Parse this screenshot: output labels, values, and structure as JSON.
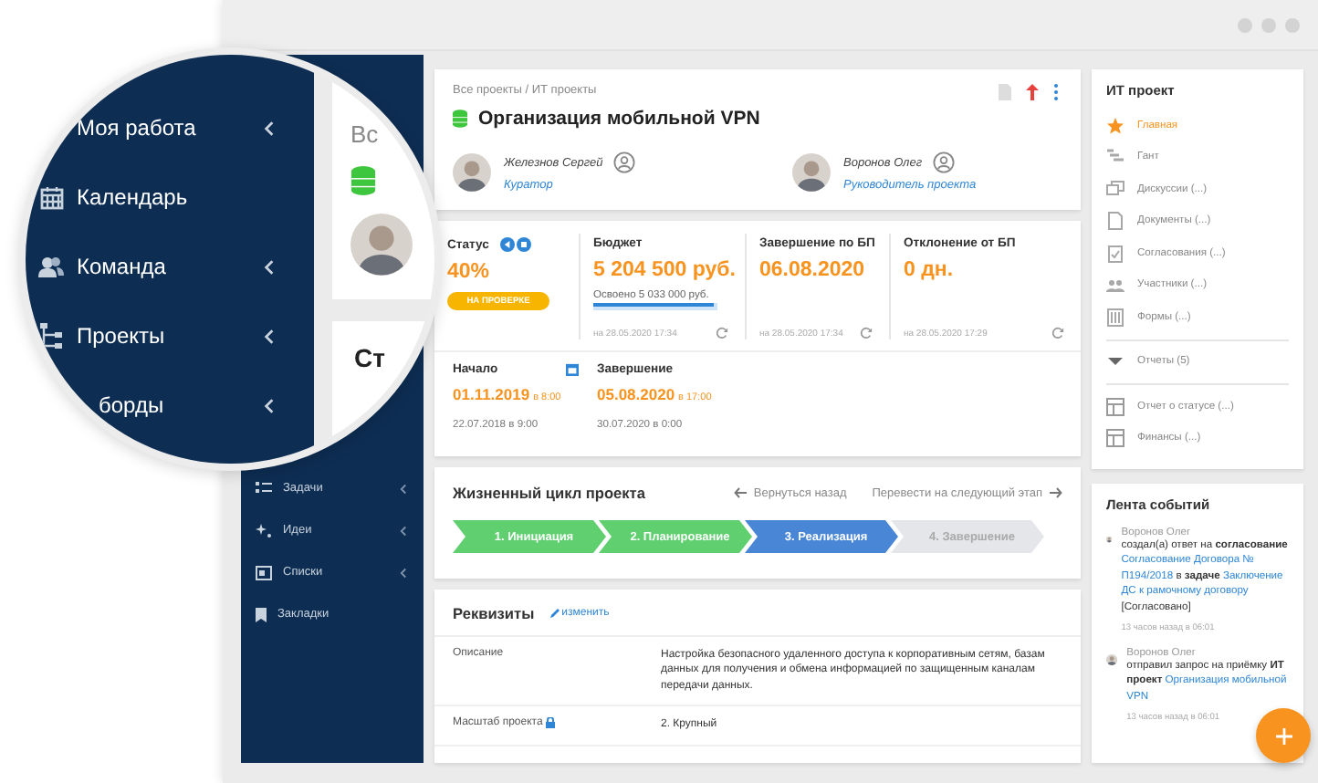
{
  "magnifier": {
    "menu": [
      {
        "label": "Моя работа",
        "expandable": true
      },
      {
        "label": "Календарь",
        "expandable": false
      },
      {
        "label": "Команда",
        "expandable": true
      },
      {
        "label": "Проекты",
        "expandable": true
      },
      {
        "label": "борды",
        "expandable": true
      }
    ],
    "card_texts": [
      "Вс",
      "Ст"
    ]
  },
  "sidebar": {
    "items": [
      {
        "label": "Задачи",
        "expandable": true
      },
      {
        "label": "Идеи",
        "expandable": true
      },
      {
        "label": "Списки",
        "expandable": true
      },
      {
        "label": "Закладки",
        "expandable": false
      }
    ]
  },
  "header": {
    "breadcrumb": "Все проекты / ИТ проекты",
    "title": "Организация мобильной VPN",
    "people": [
      {
        "name": "Железнов Сергей",
        "role": "Куратор"
      },
      {
        "name": "Воронов Олег",
        "role": "Руководитель проекта"
      }
    ]
  },
  "metrics": [
    {
      "kind": "status",
      "label": "Статус",
      "value": "40%",
      "badge": "НА ПРОВЕРКЕ"
    },
    {
      "kind": "budget",
      "label": "Бюджет",
      "value": "5 204 500 руб.",
      "note": "Освоено  5 033 000 руб.",
      "level": 0.97,
      "updated": "на 28.05.2020 17:34"
    },
    {
      "kind": "plain",
      "label": "Завершение по БП",
      "value": "06.08.2020",
      "updated": "на 28.05.2020 17:34"
    },
    {
      "kind": "plain",
      "label": "Отклонение от БП",
      "value": "0 дн.",
      "updated": "на 28.05.2020 17:29"
    }
  ],
  "dates": [
    {
      "label": "Начало",
      "value": "01.11.2019",
      "time": "в 8:00",
      "baseline": "22.07.2018 в 9:00"
    },
    {
      "label": "Завершение",
      "value": "05.08.2020",
      "time": "в 17:00",
      "baseline": "30.07.2020 в 0:00"
    }
  ],
  "lifecycle": {
    "title": "Жизненный цикл проекта",
    "back": "Вернуться назад",
    "next": "Перевести на следующий этап",
    "stages": [
      {
        "label": "1. Инициация",
        "kind": "done"
      },
      {
        "label": "2. Планирование",
        "kind": "done"
      },
      {
        "label": "3. Реализация",
        "kind": "current"
      },
      {
        "label": "4. Завершение",
        "kind": "pending"
      }
    ]
  },
  "requisites": {
    "title": "Реквизиты",
    "edit": "изменить",
    "rows": [
      {
        "label": "Описание",
        "value": "Настройка безопасного удаленного доступа к корпоративным сетям, базам данных для получения и обмена информацией по защищенным каналам передачи данных.",
        "locked": false
      },
      {
        "label": "Масштаб проекта",
        "value": "2. Крупный",
        "locked": true
      }
    ]
  },
  "project_nav": {
    "title": "ИТ проект",
    "items": [
      {
        "label": "Главная",
        "selected": true
      },
      {
        "label": "Гант",
        "selected": false
      },
      {
        "label": "Дискуссии (...)",
        "selected": false
      },
      {
        "label": "Документы (...)",
        "selected": false
      },
      {
        "label": "Согласования (...)",
        "selected": false
      },
      {
        "label": "Участники (...)",
        "selected": false
      },
      {
        "label": "Формы (...)",
        "selected": false
      }
    ],
    "reports": {
      "label": "Отчеты (5)",
      "expanded": true,
      "children": [
        {
          "label": "Отчет о статусе (...)",
          "selected": false
        },
        {
          "label": "Финансы (...)",
          "selected": false
        }
      ]
    }
  },
  "events": {
    "title": "Лента событий",
    "items": [
      {
        "author": "Воронов Олег",
        "time": "13 часов назад в 06:01",
        "segments": [
          {
            "kind": "text",
            "text": "создал(а) ответ на **согласование** "
          },
          {
            "kind": "link",
            "text": "Согласование Договора № П194/2018"
          },
          {
            "kind": "text",
            "text": " в **задаче** "
          },
          {
            "kind": "link",
            "text": "Заключение ДС к рамочному договору"
          },
          {
            "kind": "text",
            "text": " [Согласовано]"
          }
        ]
      },
      {
        "author": "Воронов Олег",
        "time": "13 часов назад в 06:01",
        "segments": [
          {
            "kind": "text",
            "text": "отправил запрос на приёмку **ИТ проект** "
          },
          {
            "kind": "link",
            "text": "Организация мобильной VPN"
          }
        ]
      }
    ]
  }
}
